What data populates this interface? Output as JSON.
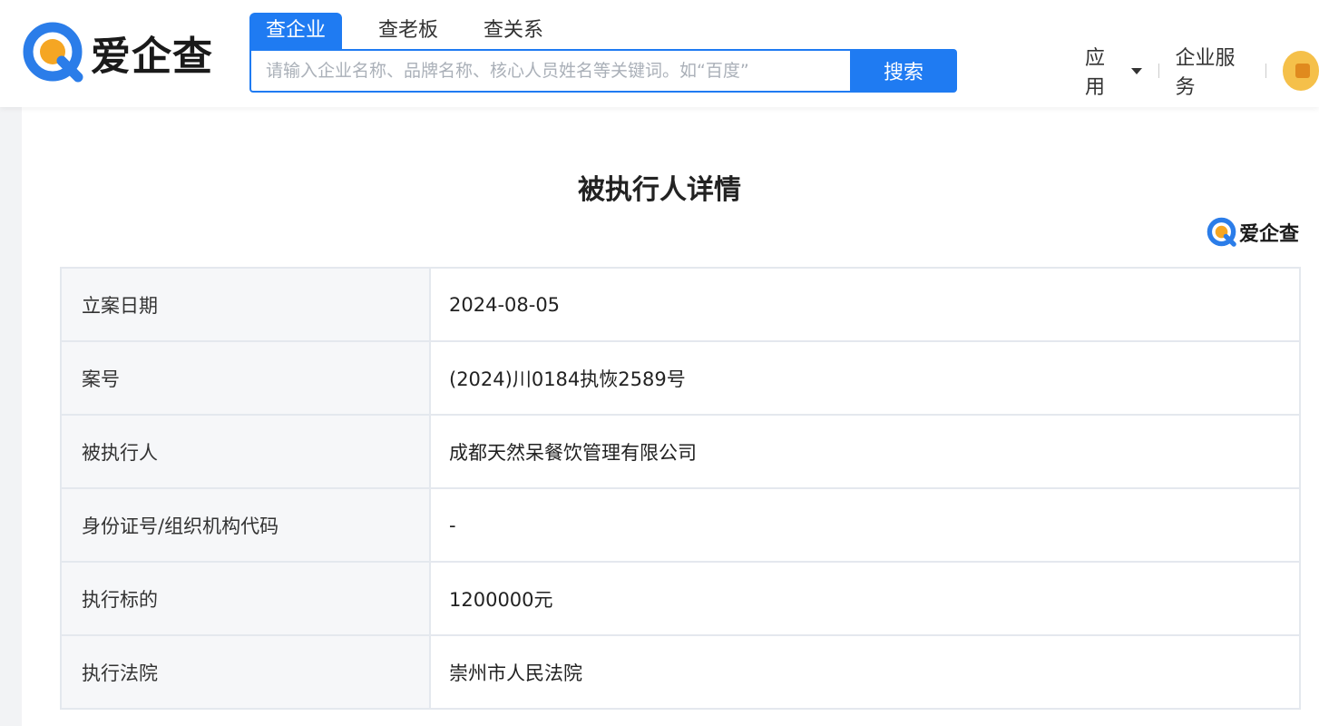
{
  "header": {
    "logo_text": "爱企查",
    "tabs": [
      {
        "label": "查企业",
        "active": true
      },
      {
        "label": "查老板",
        "active": false
      },
      {
        "label": "查关系",
        "active": false
      }
    ],
    "search": {
      "placeholder": "请输入企业名称、品牌名称、核心人员姓名等关键词。如“百度”",
      "button_label": "搜索"
    },
    "nav": {
      "apps_label": "应用",
      "services_label": "企业服务"
    }
  },
  "page": {
    "title": "被执行人详情",
    "watermark_text": "爱企查"
  },
  "details": [
    {
      "label": "立案日期",
      "value": "2024-08-05"
    },
    {
      "label": "案号",
      "value": "(2024)川0184执恢2589号"
    },
    {
      "label": "被执行人",
      "value": "成都天然呆餐饮管理有限公司"
    },
    {
      "label": "身份证号/组织机构代码",
      "value": "-"
    },
    {
      "label": "执行标的",
      "value": "1200000元"
    },
    {
      "label": "执行法院",
      "value": "崇州市人民法院"
    }
  ],
  "colors": {
    "accent": "#1f7bf2",
    "logo_blue": "#2b7de9",
    "logo_orange": "#f5a623"
  }
}
